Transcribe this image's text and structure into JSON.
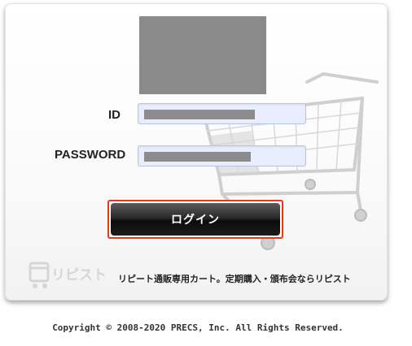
{
  "login_form": {
    "id_label": "ID",
    "password_label": "PASSWORD",
    "login_button": "ログイン"
  },
  "branding": {
    "logo_text": "リピスト",
    "tagline": "リピート通販専用カート。定期購入・頒布会ならリピスト"
  },
  "footer": {
    "copyright": "Copyright © 2008-2020 PRECS, Inc. All Rights Reserved."
  },
  "colors": {
    "button_border": "#e23a14",
    "field_background": "#e9eeff"
  },
  "icons": [
    "shopping-cart-illustration",
    "repist-logo-icon"
  ]
}
